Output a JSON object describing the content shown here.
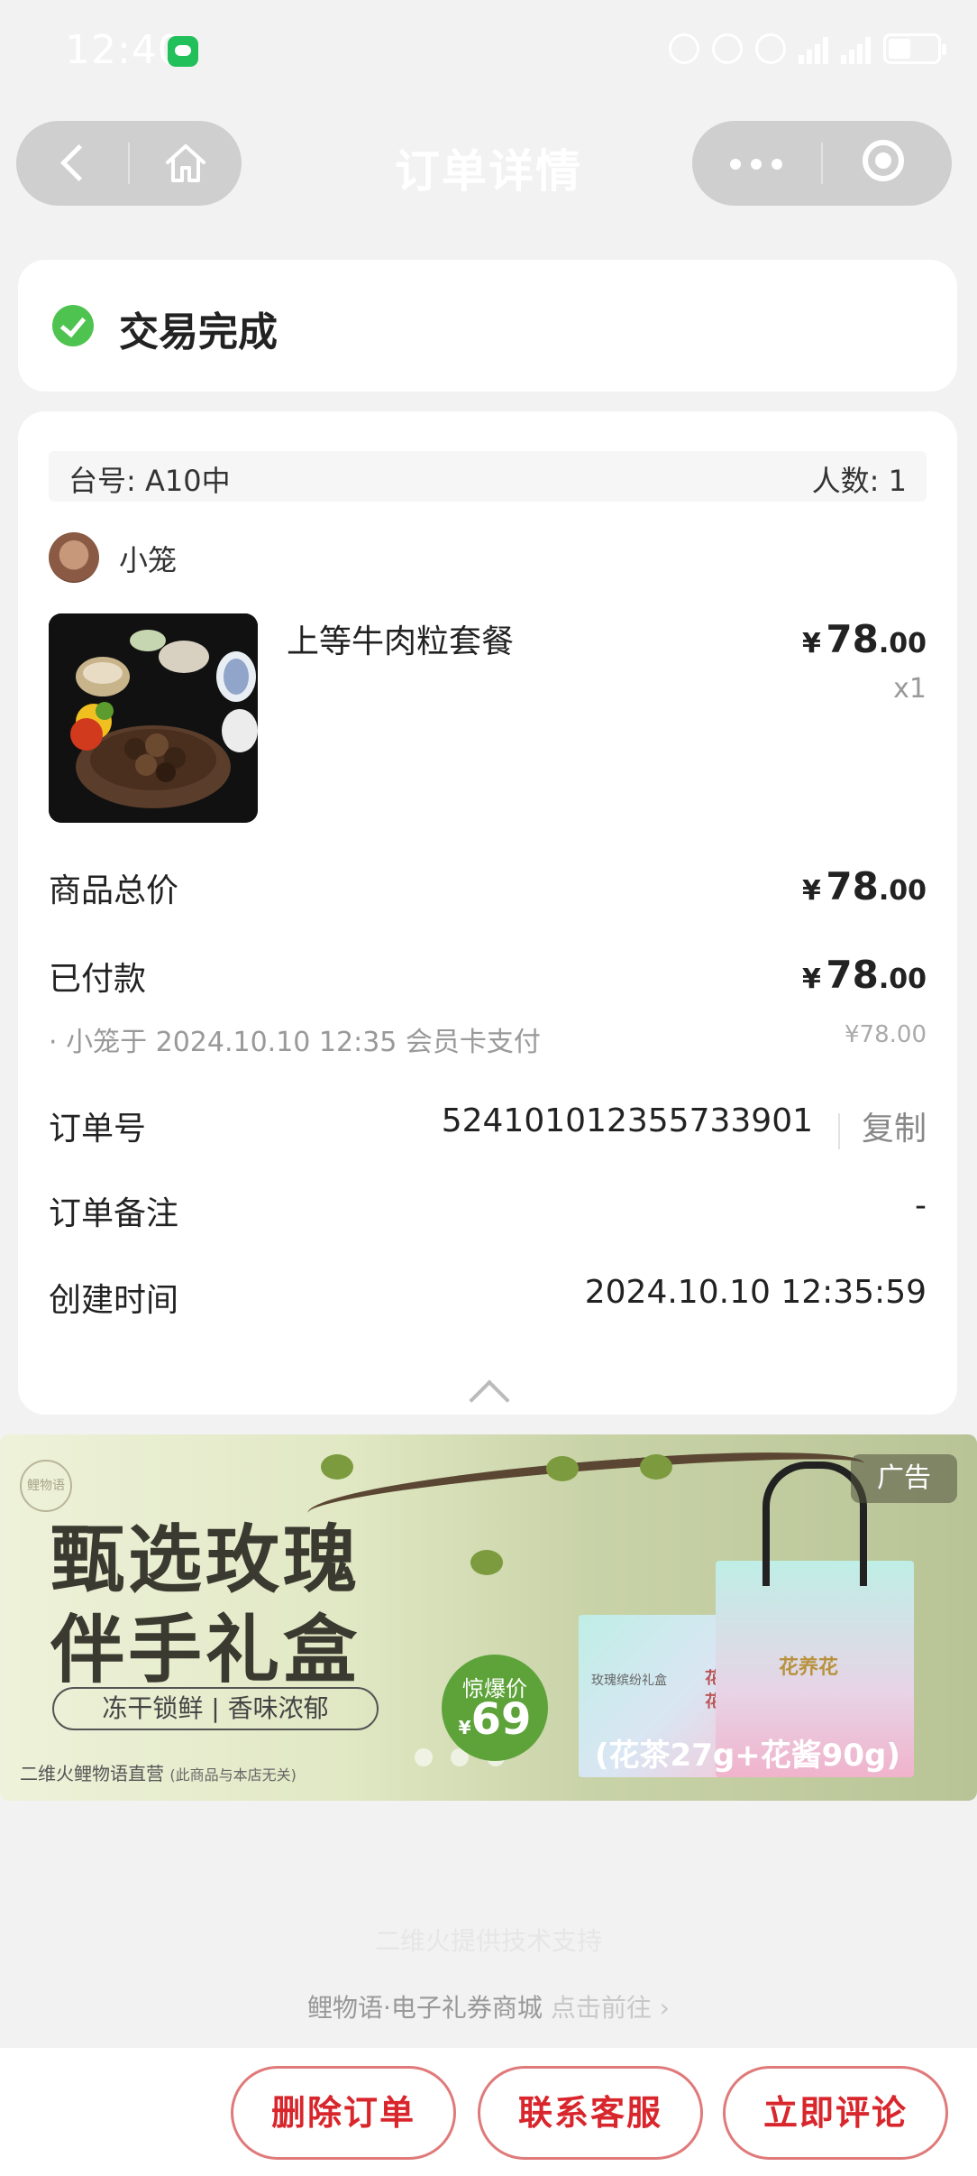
{
  "status_bar": {
    "time": "12:40"
  },
  "nav": {
    "title": "订单详情"
  },
  "order_status": {
    "text": "交易完成"
  },
  "table_info": {
    "table_label": "台号: A10中",
    "people_label": "人数: 1"
  },
  "user": {
    "name": "小笼"
  },
  "product": {
    "name": "上等牛肉粒套餐",
    "price_currency": "¥",
    "price_int": "78",
    "price_dec": ".00",
    "quantity": "x1"
  },
  "summary": {
    "total_label": "商品总价",
    "total_currency": "¥",
    "total_int": "78",
    "total_dec": ".00",
    "paid_label": "已付款",
    "paid_currency": "¥",
    "paid_int": "78",
    "paid_dec": ".00",
    "pay_detail": "· 小笼于 2024.10.10 12:35 会员卡支付",
    "pay_detail_amount": "¥78.00"
  },
  "order_details": {
    "order_no_label": "订单号",
    "order_no": "524101012355733901",
    "copy_label": "复制",
    "remark_label": "订单备注",
    "remark_value": "-",
    "created_label": "创建时间",
    "created_value": "2024.10.10 12:35:59"
  },
  "ad": {
    "logo": "鲤物语",
    "title_line1": "甄选玫瑰",
    "title_line2": "伴手礼盒",
    "pill": "冻干锁鲜 | 香味浓郁",
    "footer": "二维火鲤物语直营",
    "footer_note": "(此商品与本店无关)",
    "badge_text": "惊爆价",
    "badge_currency": "¥",
    "badge_price": "69",
    "tag": "广告",
    "box_label": "玫瑰缤纷礼盒",
    "brand": "花养花",
    "subtitle": "(花茶27g+花酱90g)"
  },
  "footer": {
    "support": "二维火提供技术支持",
    "link_text": "鲤物语·电子礼券商城",
    "link_action": "点击前往 ›"
  },
  "actions": {
    "delete": "删除订单",
    "contact": "联系客服",
    "review": "立即评论"
  },
  "colors": {
    "accent_red": "#d8262c",
    "success_green": "#4fc34f",
    "background": "#f2f2f2"
  }
}
